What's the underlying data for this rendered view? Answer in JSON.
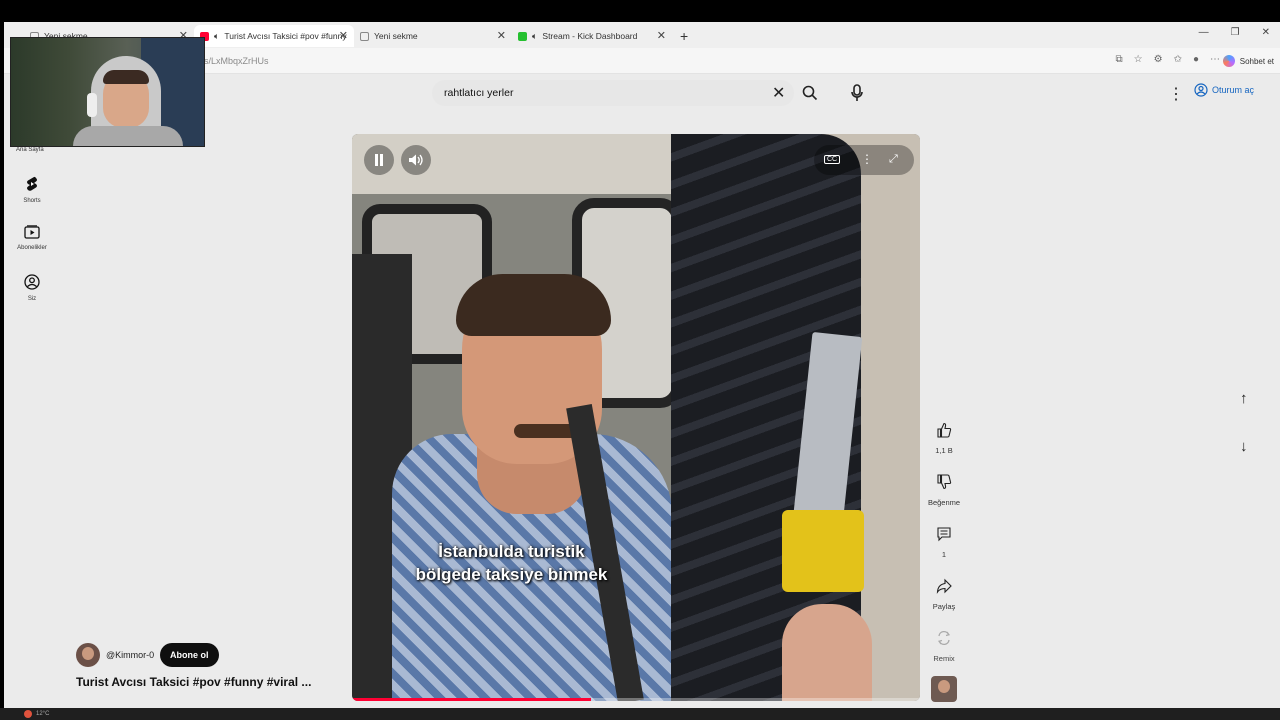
{
  "browser": {
    "tabs": [
      {
        "label": "Yeni sekme",
        "favicon": "new-tab-icon"
      },
      {
        "label": "Turist Avcısı Taksici #pov #funny",
        "favicon": "youtube-icon",
        "active": true
      },
      {
        "label": "Yeni sekme",
        "favicon": "new-tab-icon"
      },
      {
        "label": "Stream - Kick Dashboard",
        "favicon": "kick-icon"
      }
    ],
    "url": "s/LxMbqxZrHUs",
    "copilot_label": "Sohbet et",
    "accent": "#1565c0"
  },
  "header": {
    "search_value": "rahtlatıcı yerler",
    "signin_label": "Oturum aç"
  },
  "webcam": {
    "label": "Ana Sayfa"
  },
  "sidebar": {
    "items": [
      {
        "label": "Shorts",
        "icon": "shorts-icon"
      },
      {
        "label": "Abonelikler",
        "icon": "subscriptions-icon"
      },
      {
        "label": "Siz",
        "icon": "you-icon"
      }
    ]
  },
  "video": {
    "caption_lines": [
      "İstanbulda turistik",
      "bölgede taksiye binmek"
    ],
    "progress": 0.42,
    "progress_color": "#ff0033",
    "cc_label": "CC"
  },
  "actions": {
    "likes": "1,1 B",
    "dislike_label": "Beğenme",
    "comments": "1",
    "share_label": "Paylaş",
    "remix_label": "Remix"
  },
  "channel": {
    "handle": "@Kimmor-0",
    "subscribe_label": "Abone ol",
    "title": "Turist Avcısı Taksici #pov #funny #viral ..."
  },
  "taskbar": {
    "left_text": "12°C"
  }
}
